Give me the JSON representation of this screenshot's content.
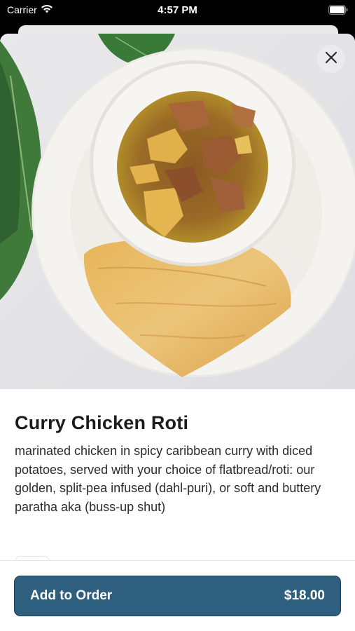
{
  "status_bar": {
    "carrier": "Carrier",
    "time": "4:57 PM",
    "icons": [
      "wifi-icon",
      "battery-icon"
    ]
  },
  "hero_image": {
    "alt": "Curry Chicken Roti dish photo"
  },
  "close_button": {
    "icon": "close-icon"
  },
  "item": {
    "title": "Curry Chicken Roti",
    "description": "marinated chicken in spicy caribbean curry with diced potatoes, served with your choice of flatbread/roti: our golden, split-pea infused (dahl-puri), or soft and buttery paratha aka (buss-up shut)"
  },
  "order": {
    "add_label": "Add to Order",
    "price": "$18.00"
  },
  "colors": {
    "accent": "#2f5f7e",
    "accent_border": "#1f425a",
    "background": "#ffffff"
  }
}
